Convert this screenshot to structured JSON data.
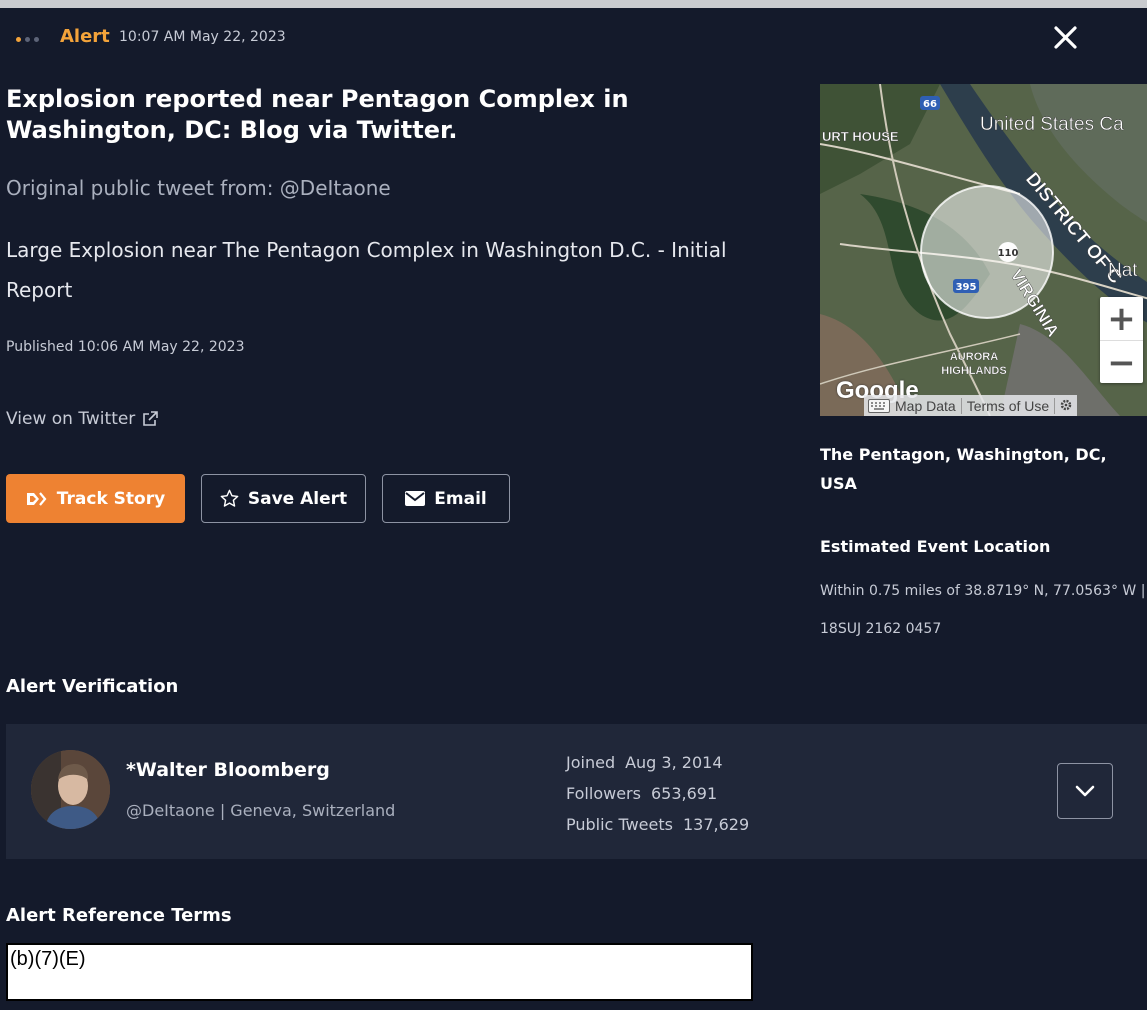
{
  "header": {
    "label": "Alert",
    "timestamp": "10:07 AM May 22, 2023",
    "close_icon": "close-icon"
  },
  "article": {
    "headline": "Explosion reported near Pentagon Complex in Washington, DC: Blog via Twitter.",
    "source_line": "Original public tweet from: @DeItaone",
    "tweet_text": "Large Explosion near The Pentagon Complex in Washington D.C. - Initial Report",
    "published": "Published 10:06 AM May 22, 2023",
    "view_link": "View on Twitter"
  },
  "actions": {
    "track_label": "Track Story",
    "save_label": "Save Alert",
    "email_label": "Email"
  },
  "map": {
    "labels": {
      "court_house": "URT HOUSE",
      "us_capitol": "United States Ca",
      "district": "DISTRICT OF C",
      "virginia": "VIRGINIA",
      "aurora": "AURORA",
      "highlands": "HIGHLANDS",
      "nat": "Nat",
      "shield_66": "66",
      "shield_110": "110",
      "shield_395": "395"
    },
    "logo": "Google",
    "footer_data": "Map Data",
    "footer_terms": "Terms of Use",
    "zoom_in": "+",
    "zoom_out": "−"
  },
  "location": {
    "place": "The Pentagon, Washington, DC, USA",
    "est_title": "Estimated Event Location",
    "est_detail": "Within 0.75 miles of 38.8719° N, 77.0563° W | 18SUJ 2162 0457"
  },
  "verification": {
    "title": "Alert Verification",
    "name": "*Walter Bloomberg",
    "handle": "@DeItaone | Geneva, Switzerland",
    "joined_label": "Joined",
    "joined_value": "Aug 3, 2014",
    "followers_label": "Followers",
    "followers_value": "653,691",
    "tweets_label": "Public Tweets",
    "tweets_value": "137,629"
  },
  "reference": {
    "title": "Alert Reference Terms",
    "value": "(b)(7)(E)"
  },
  "colors": {
    "background": "#141a2b",
    "accent": "#f3a33a",
    "track_button": "#ee8232",
    "card": "#202739"
  }
}
